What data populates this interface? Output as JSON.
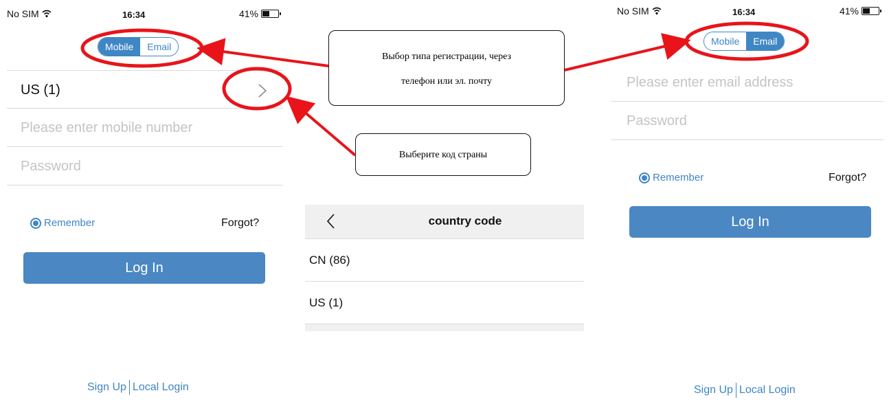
{
  "status_bar": {
    "carrier": "No SIM",
    "time": "16:34",
    "battery": "41%"
  },
  "left_screen": {
    "tabs": {
      "mobile": "Mobile",
      "email": "Email",
      "active": "mobile"
    },
    "country_value": "US (1)",
    "mobile_placeholder": "Please enter mobile number",
    "password_placeholder": "Password",
    "remember_label": "Remember",
    "forgot_label": "Forgot?",
    "login_label": "Log In",
    "signup_label": "Sign Up",
    "local_login_label": "Local Login"
  },
  "country_screen": {
    "title": "country code",
    "items": [
      "CN (86)",
      "US (1)"
    ]
  },
  "right_screen": {
    "tabs": {
      "mobile": "Mobile",
      "email": "Email",
      "active": "email"
    },
    "email_placeholder": "Please enter email address",
    "password_placeholder": "Password",
    "remember_label": "Remember",
    "forgot_label": "Forgot?",
    "login_label": "Log In",
    "signup_label": "Sign Up",
    "local_login_label": "Local Login"
  },
  "callouts": {
    "registration_type_line1": "Выбор типа регистрации, через",
    "registration_type_line2": "телефон или эл. почту",
    "country_code": "Выберите код страны"
  },
  "colors": {
    "accent": "#3f86c4",
    "annotation": "#e8141a"
  }
}
